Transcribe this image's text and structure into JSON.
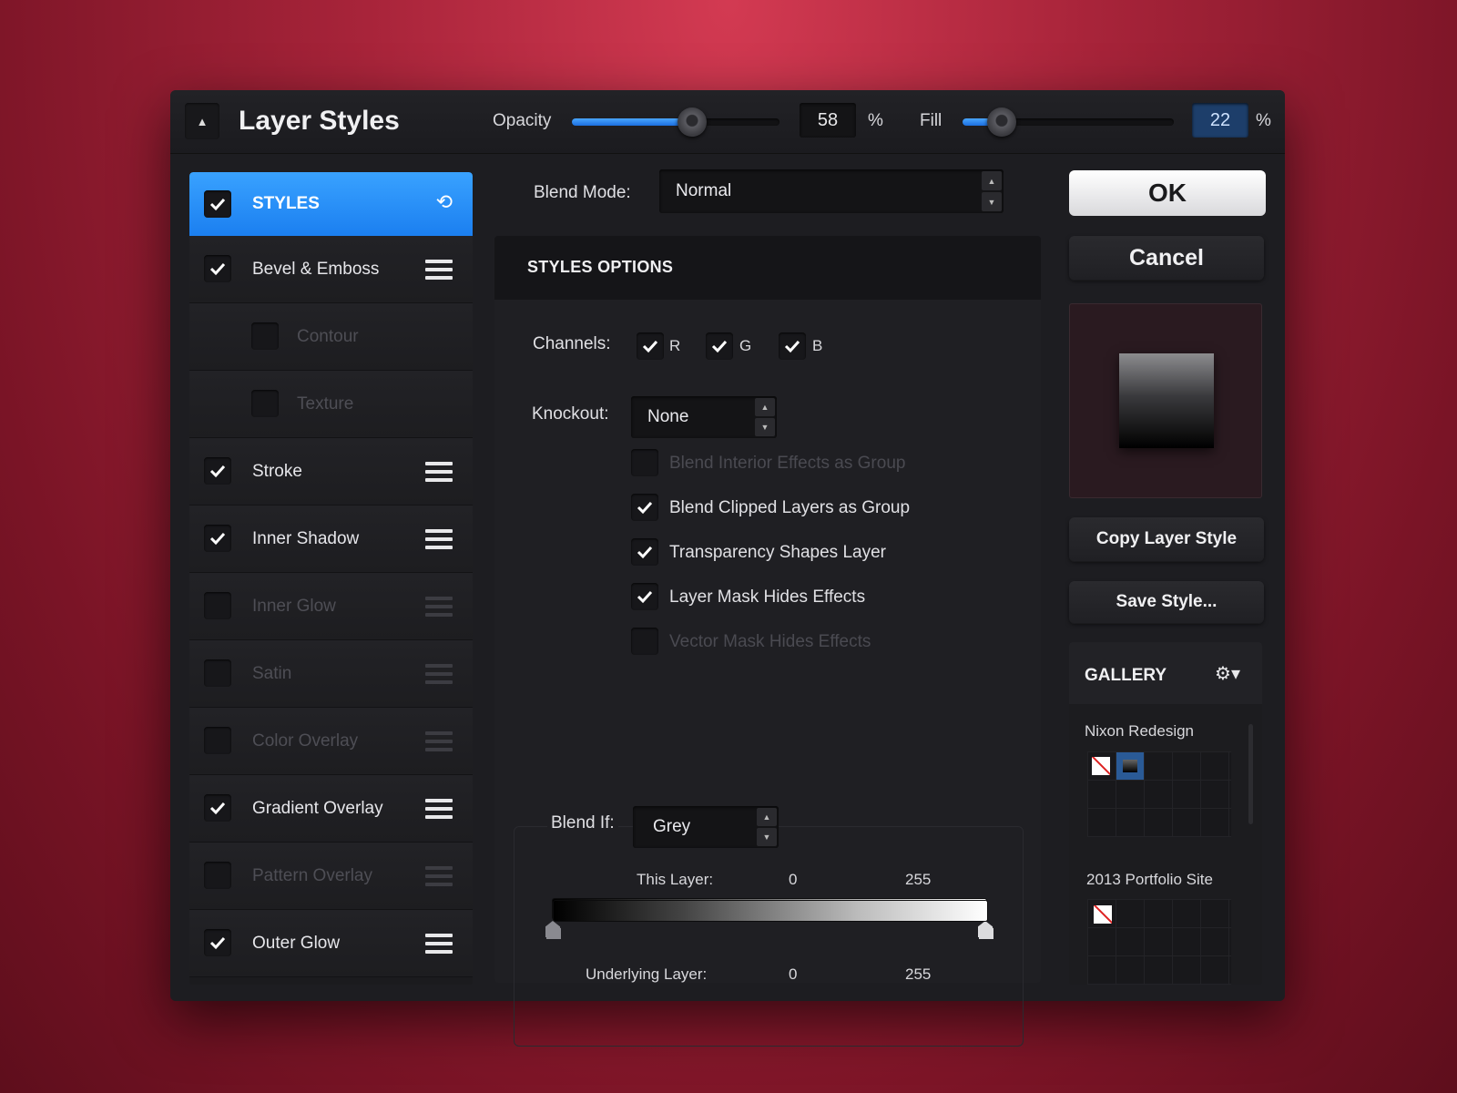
{
  "window": {
    "title": "Layer Styles",
    "opacity": {
      "label": "Opacity",
      "value": "58",
      "unit": "%",
      "fraction": 0.58
    },
    "fill": {
      "label": "Fill",
      "value": "22",
      "unit": "%",
      "fraction": 0.22
    }
  },
  "styles_list": {
    "header": {
      "label": "STYLES",
      "checked": true
    },
    "items": [
      {
        "label": "Bevel & Emboss",
        "checked": true,
        "enabled": true
      },
      {
        "label": "Contour",
        "checked": false,
        "enabled": false
      },
      {
        "label": "Texture",
        "checked": false,
        "enabled": false
      },
      {
        "label": "Stroke",
        "checked": true,
        "enabled": true
      },
      {
        "label": "Inner Shadow",
        "checked": true,
        "enabled": true
      },
      {
        "label": "Inner Glow",
        "checked": false,
        "enabled": false
      },
      {
        "label": "Satin",
        "checked": false,
        "enabled": false
      },
      {
        "label": "Color Overlay",
        "checked": false,
        "enabled": false
      },
      {
        "label": "Gradient Overlay",
        "checked": true,
        "enabled": true
      },
      {
        "label": "Pattern Overlay",
        "checked": false,
        "enabled": false
      },
      {
        "label": "Outer Glow",
        "checked": true,
        "enabled": true
      }
    ]
  },
  "blend_mode": {
    "label": "Blend Mode:",
    "value": "Normal"
  },
  "options": {
    "title": "STYLES OPTIONS",
    "channels": {
      "label": "Channels:",
      "r": "R",
      "g": "G",
      "b": "B"
    },
    "knockout": {
      "label": "Knockout:",
      "value": "None"
    },
    "checks": [
      {
        "label": "Blend Interior Effects as Group",
        "checked": false
      },
      {
        "label": "Blend Clipped Layers as Group",
        "checked": true
      },
      {
        "label": "Transparency Shapes Layer",
        "checked": true
      },
      {
        "label": "Layer Mask Hides Effects",
        "checked": true
      },
      {
        "label": "Vector Mask Hides Effects",
        "checked": false
      }
    ],
    "blend_if": {
      "label": "Blend If:",
      "value": "Grey",
      "this_layer": {
        "label": "This Layer:",
        "min": "0",
        "max": "255"
      },
      "underlying_layer": {
        "label": "Underlying Layer:",
        "min": "0",
        "max": "255"
      }
    }
  },
  "buttons": {
    "ok": "OK",
    "cancel": "Cancel",
    "copy": "Copy Layer Style",
    "save": "Save Style..."
  },
  "gallery": {
    "title": "GALLERY",
    "groups": [
      "Nixon Redesign",
      "2013 Portfolio Site"
    ]
  },
  "colors": {
    "accent": "#2b8cf7",
    "background": "#a8243a"
  }
}
